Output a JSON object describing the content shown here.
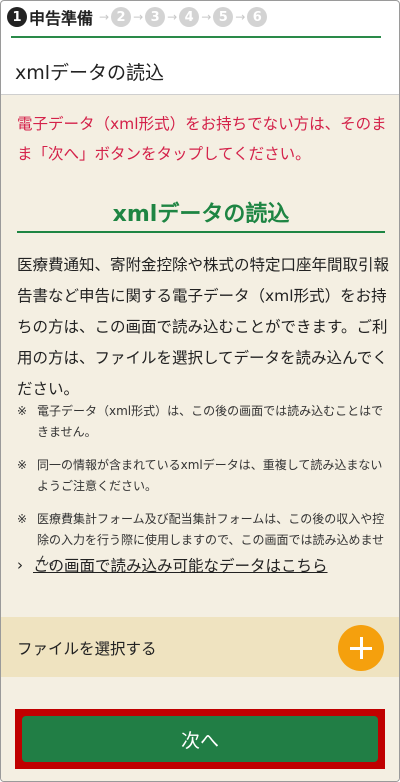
{
  "steps": {
    "current_number": "1",
    "current_label": "申告準備",
    "others": [
      "2",
      "3",
      "4",
      "5",
      "6"
    ],
    "arrow": "→"
  },
  "page_title": "xmlデータの読込",
  "notice": "電子データ（xml形式）をお持ちでない方は、そのまま「次へ」ボタンをタップしてください。",
  "section_title": "xmlデータの読込",
  "body": "医療費通知、寄附金控除や株式の特定口座年間取引報告書など申告に関する電子データ（xml形式）をお持ちの方は、この画面で読み込むことができます。ご利用の方は、ファイルを選択してデータを読み込んでください。",
  "notes": [
    {
      "mark": "※",
      "text": "電子データ（xml形式）は、この後の画面では読み込むことはできません。"
    },
    {
      "mark": "※",
      "text": "同一の情報が含まれているxmlデータは、重複して読み込まないようご注意ください。"
    },
    {
      "mark": "※",
      "text": "医療費集計フォーム及び配当集計フォームは、この後の収入や控除の入力を行う際に使用しますので、この画面では読み込めません。"
    }
  ],
  "link": {
    "chevron": "›",
    "text": "この画面で読み込み可能なデータはこちら"
  },
  "file_select": {
    "label": "ファイルを選択する"
  },
  "next_button": {
    "label": "次へ"
  },
  "colors": {
    "brand_green": "#217e45",
    "notice_red": "#d4224a",
    "beige_bg": "#f4efe2",
    "file_row_bg": "#efe3c0",
    "add_orange": "#f5a00d",
    "highlight_red": "#c00000"
  }
}
